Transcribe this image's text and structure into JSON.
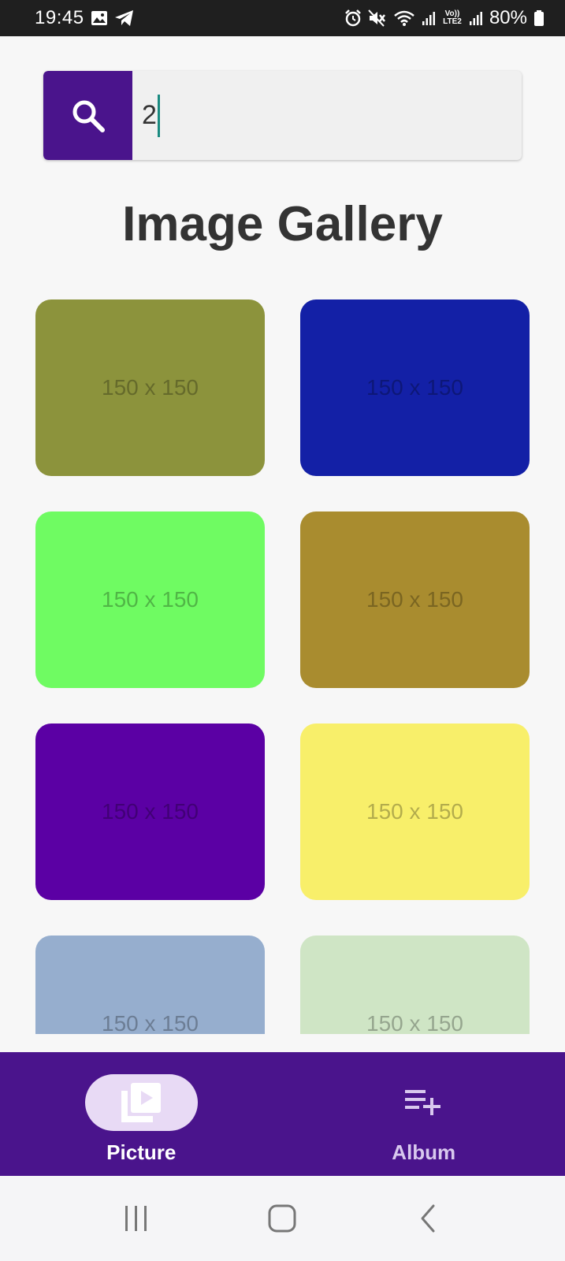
{
  "status_bar": {
    "time": "19:45",
    "battery_percent": "80%",
    "network_label": "Vo)) LTE2",
    "left_icons": [
      "gallery-icon",
      "telegram-icon"
    ],
    "right_icons": [
      "alarm-icon",
      "mute-icon",
      "wifi-icon",
      "signal-icon",
      "lte-icon",
      "signal-icon",
      "battery-icon"
    ]
  },
  "search": {
    "value": "2",
    "icon": "search-icon"
  },
  "page": {
    "title": "Image Gallery"
  },
  "gallery": {
    "tiles": [
      {
        "label": "150 x 150",
        "color": "#8c933c"
      },
      {
        "label": "150 x 150",
        "color": "#1320a6"
      },
      {
        "label": "150 x 150",
        "color": "#6ffb62"
      },
      {
        "label": "150 x 150",
        "color": "#a98c2f"
      },
      {
        "label": "150 x 150",
        "color": "#5b00a4"
      },
      {
        "label": "150 x 150",
        "color": "#f8ef6a"
      },
      {
        "label": "150 x 150",
        "color": "#96aece"
      },
      {
        "label": "150 x 150",
        "color": "#cfe5c5"
      }
    ]
  },
  "bottom_nav": {
    "items": [
      {
        "label": "Picture",
        "icon": "video-library-icon",
        "active": true
      },
      {
        "label": "Album",
        "icon": "playlist-add-icon",
        "active": false
      }
    ]
  },
  "colors": {
    "accent": "#4a148c",
    "active_pill": "#e8daf5",
    "caret": "#1a8a80"
  }
}
